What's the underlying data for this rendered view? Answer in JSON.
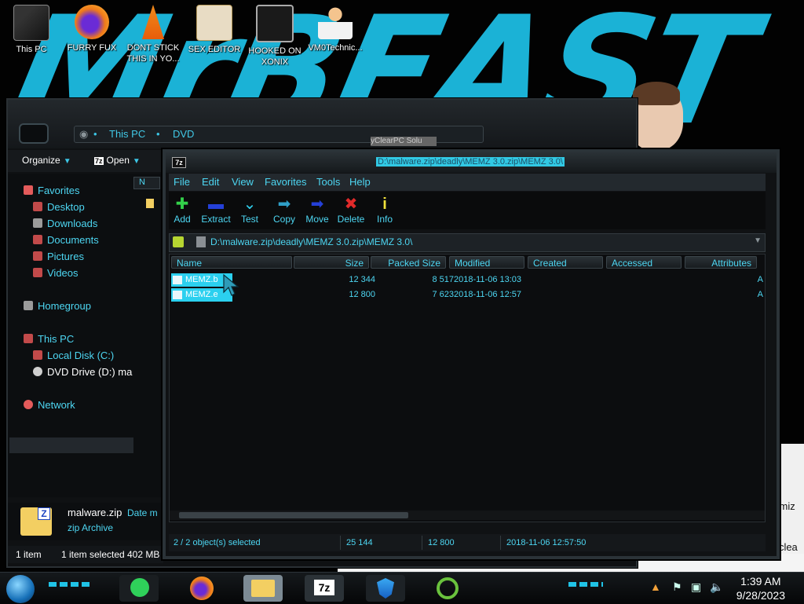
{
  "desktop": {
    "icons": [
      {
        "label": "This PC"
      },
      {
        "label": "FURRY FUX"
      },
      {
        "label": "DONT STICK THIS IN YO..."
      },
      {
        "label": "SEX EDITOR"
      },
      {
        "label": "HOOKED ON XONIX"
      },
      {
        "label": "VM0Technic..."
      }
    ],
    "bg_partial_text": [
      "timiz",
      "r clea"
    ]
  },
  "explorer": {
    "address": [
      "This PC",
      "DVD"
    ],
    "toolbar": {
      "organize": "Organize",
      "open": "Open"
    },
    "nav": [
      {
        "label": "Favorites",
        "color": "#e45b5b"
      },
      {
        "label": "Desktop",
        "color": "#c24a4a"
      },
      {
        "label": "Downloads",
        "color": "#9b9b9b"
      },
      {
        "label": "Documents",
        "color": "#c24a4a"
      },
      {
        "label": "Pictures",
        "color": "#c24a4a"
      },
      {
        "label": "Videos",
        "color": "#c24a4a"
      },
      {
        "label": "Homegroup",
        "color": "#9b9b9b"
      },
      {
        "label": "This PC",
        "color": "#c24a4a"
      },
      {
        "label": "Local Disk (C:)",
        "color": "#c24a4a"
      },
      {
        "label": "DVD Drive (D:) ma",
        "color": "#cfcfcf"
      },
      {
        "label": "Network",
        "color": "#e45b5b"
      }
    ],
    "column_stub": "N",
    "details": {
      "name": "malware.zip",
      "type": "zip Archive",
      "date_label": "Date m"
    },
    "status": {
      "count": "1 item",
      "selected": "1 item selected",
      "size": "402 MB"
    },
    "hidden_tab_text": "yClearPC Solu"
  },
  "sevenzip": {
    "logo": "7z",
    "title": "D:\\malware.zip\\deadly\\MEMZ 3.0.zip\\MEMZ 3.0\\",
    "menu": [
      "File",
      "Edit",
      "View",
      "Favorites",
      "Tools",
      "Help"
    ],
    "tools": [
      {
        "label": "Add",
        "glyph": "✚",
        "color": "#33d04a"
      },
      {
        "label": "Extract",
        "glyph": "▬",
        "color": "#2440d8"
      },
      {
        "label": "Test",
        "glyph": "⌄",
        "color": "#2fd0ef"
      },
      {
        "label": "Copy",
        "glyph": "➡",
        "color": "#2f9fc7"
      },
      {
        "label": "Move",
        "glyph": "➡",
        "color": "#2440d8"
      },
      {
        "label": "Delete",
        "glyph": "✖",
        "color": "#e12a2a"
      },
      {
        "label": "Info",
        "glyph": "i",
        "color": "#f1e23a"
      }
    ],
    "path": "D:\\malware.zip\\deadly\\MEMZ 3.0.zip\\MEMZ 3.0\\",
    "columns": [
      "Name",
      "Size",
      "Packed Size",
      "Modified",
      "Created",
      "Accessed",
      "Attributes"
    ],
    "rows": [
      {
        "name": "MEMZ.b",
        "size": "12 344",
        "packed": "8 517",
        "modified": "2018-11-06 13:03",
        "attr": "A"
      },
      {
        "name": "MEMZ.e",
        "size": "12 800",
        "packed": "7 623",
        "modified": "2018-11-06 12:57",
        "attr": "A"
      }
    ],
    "status": {
      "selection": "2 / 2 object(s) selected",
      "total": "25 144",
      "packed": "12 800",
      "date": "2018-11-06 12:57:50"
    }
  },
  "taskbar": {
    "time": "1:39 AM",
    "date": "9/28/2023"
  }
}
